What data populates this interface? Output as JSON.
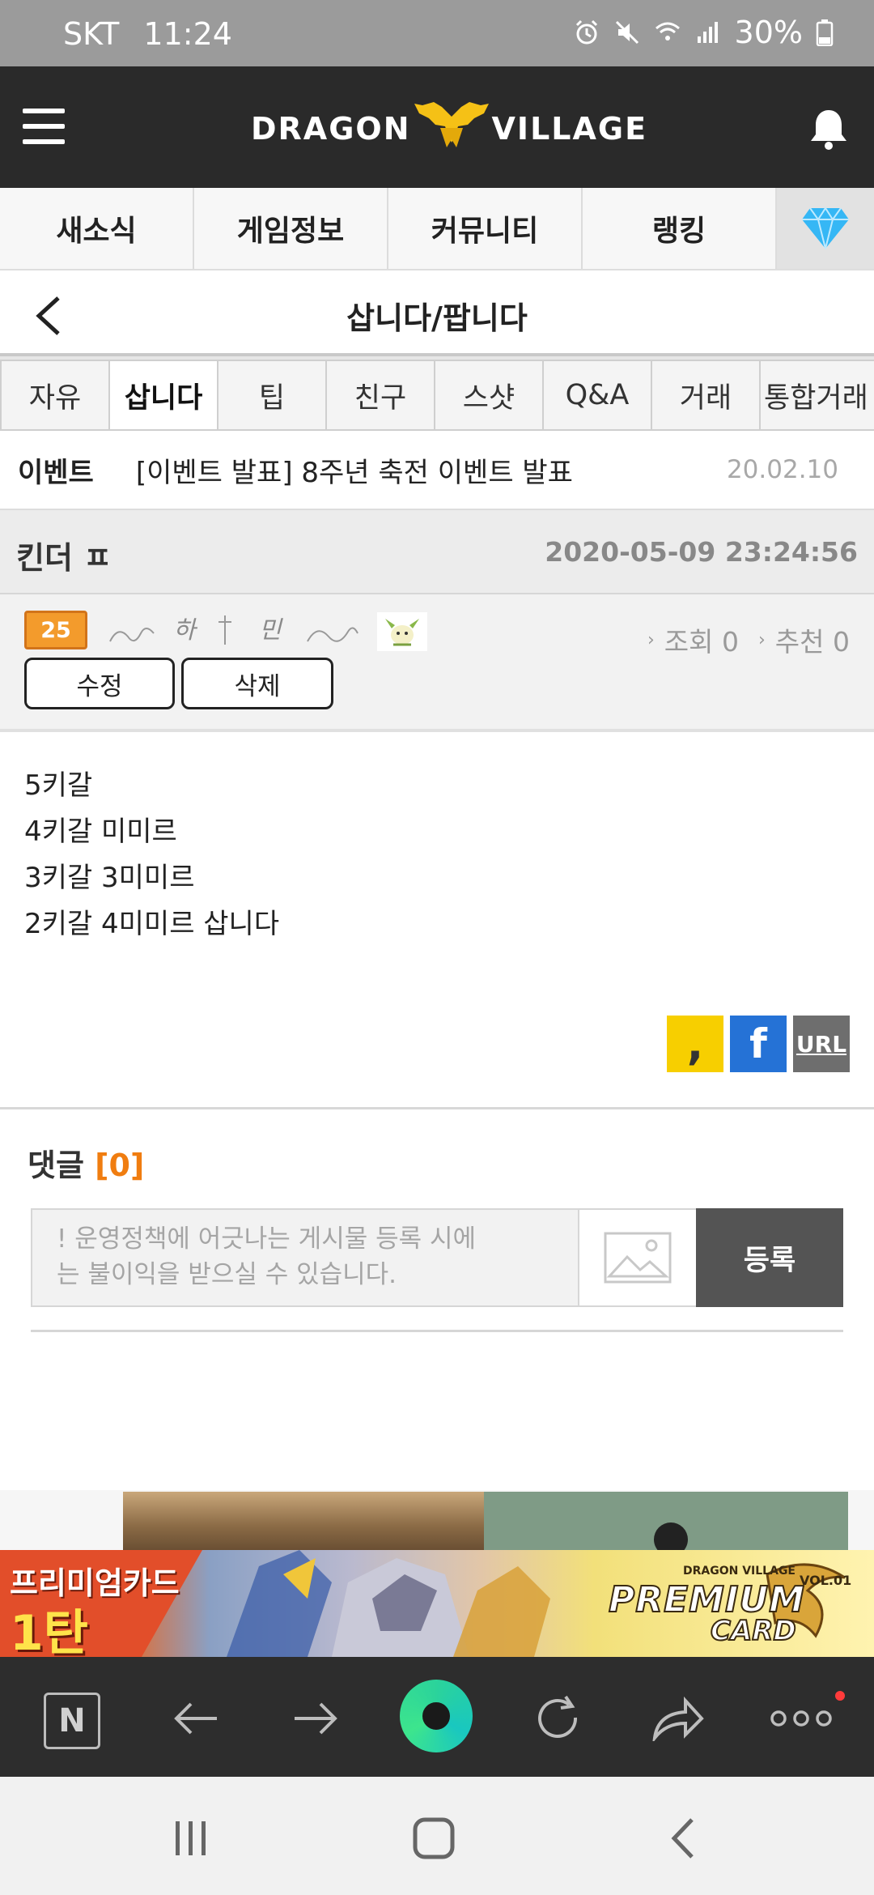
{
  "status_bar": {
    "carrier": "SKT",
    "time": "11:24",
    "battery": "30%",
    "icons": [
      "alarm-icon",
      "mute-icon",
      "wifi-icon",
      "signal-icon",
      "battery-icon"
    ]
  },
  "header": {
    "logo_left": "DRAGON",
    "logo_right": "VILLAGE",
    "icons": [
      "menu-icon",
      "bell-icon"
    ]
  },
  "main_nav": {
    "items": [
      {
        "label": "새소식"
      },
      {
        "label": "게임정보"
      },
      {
        "label": "커뮤니티"
      },
      {
        "label": "랭킹"
      }
    ],
    "gem_icon": "diamond-icon"
  },
  "page": {
    "title": "삽니다/팝니다"
  },
  "sub_tabs": {
    "items": [
      {
        "label": "자유"
      },
      {
        "label": "삽니다"
      },
      {
        "label": "팁"
      },
      {
        "label": "친구"
      },
      {
        "label": "스샷"
      },
      {
        "label": "Q&A"
      },
      {
        "label": "거래"
      },
      {
        "label": "통합거래"
      }
    ],
    "active_index": 1
  },
  "event": {
    "tag": "이벤트",
    "text": "[이벤트 발표] 8주년 축전 이벤트 발표",
    "date": "20.02.10"
  },
  "post": {
    "title": "킨더 ㅍ",
    "datetime": "2020-05-09 23:24:56",
    "author": {
      "level": "25",
      "nickname": "하 민"
    },
    "views_label": "조회 0",
    "recommend_label": "추천 0",
    "edit_label": "수정",
    "delete_label": "삭제",
    "body_lines": [
      "5키갈",
      "4키갈 미미르",
      "3키갈 3미미르",
      "2키갈 4미미르 삽니다"
    ],
    "share": {
      "kakao": ",",
      "facebook": "f",
      "url": "URL"
    }
  },
  "comments": {
    "title": "댓글",
    "count": "[0]",
    "placeholder": "! 운영정책에 어긋나는 게시물 등록 시에는 불이익을 받으실 수 있습니다.",
    "placeholder_line1": "! 운영정책에 어긋나는 게시물 등록 시에",
    "placeholder_line2": "는 불이익을 받으실 수 있습니다.",
    "submit_label": "등록"
  },
  "banner": {
    "left_line1": "프리미엄카드",
    "left_line2": "1탄",
    "brand_top": "DRAGON VILLAGE",
    "brand_vol": "VOL.01",
    "brand_main": "PREMIUM",
    "brand_sub": "CARD"
  },
  "browser_toolbar": {
    "naver_label": "N",
    "icons": [
      "naver-icon",
      "back-arrow-icon",
      "forward-arrow-icon",
      "home-icon",
      "refresh-icon",
      "share-icon",
      "more-icon"
    ]
  },
  "system_nav": {
    "icons": [
      "recent-apps-icon",
      "home-button-icon",
      "back-button-icon"
    ]
  },
  "colors": {
    "header_bg": "#2a2a2a",
    "accent_orange": "#f07d10",
    "level_badge": "#f39b2c",
    "submit_bg": "#545454",
    "kakao": "#f7cf00",
    "facebook": "#2572d6"
  }
}
